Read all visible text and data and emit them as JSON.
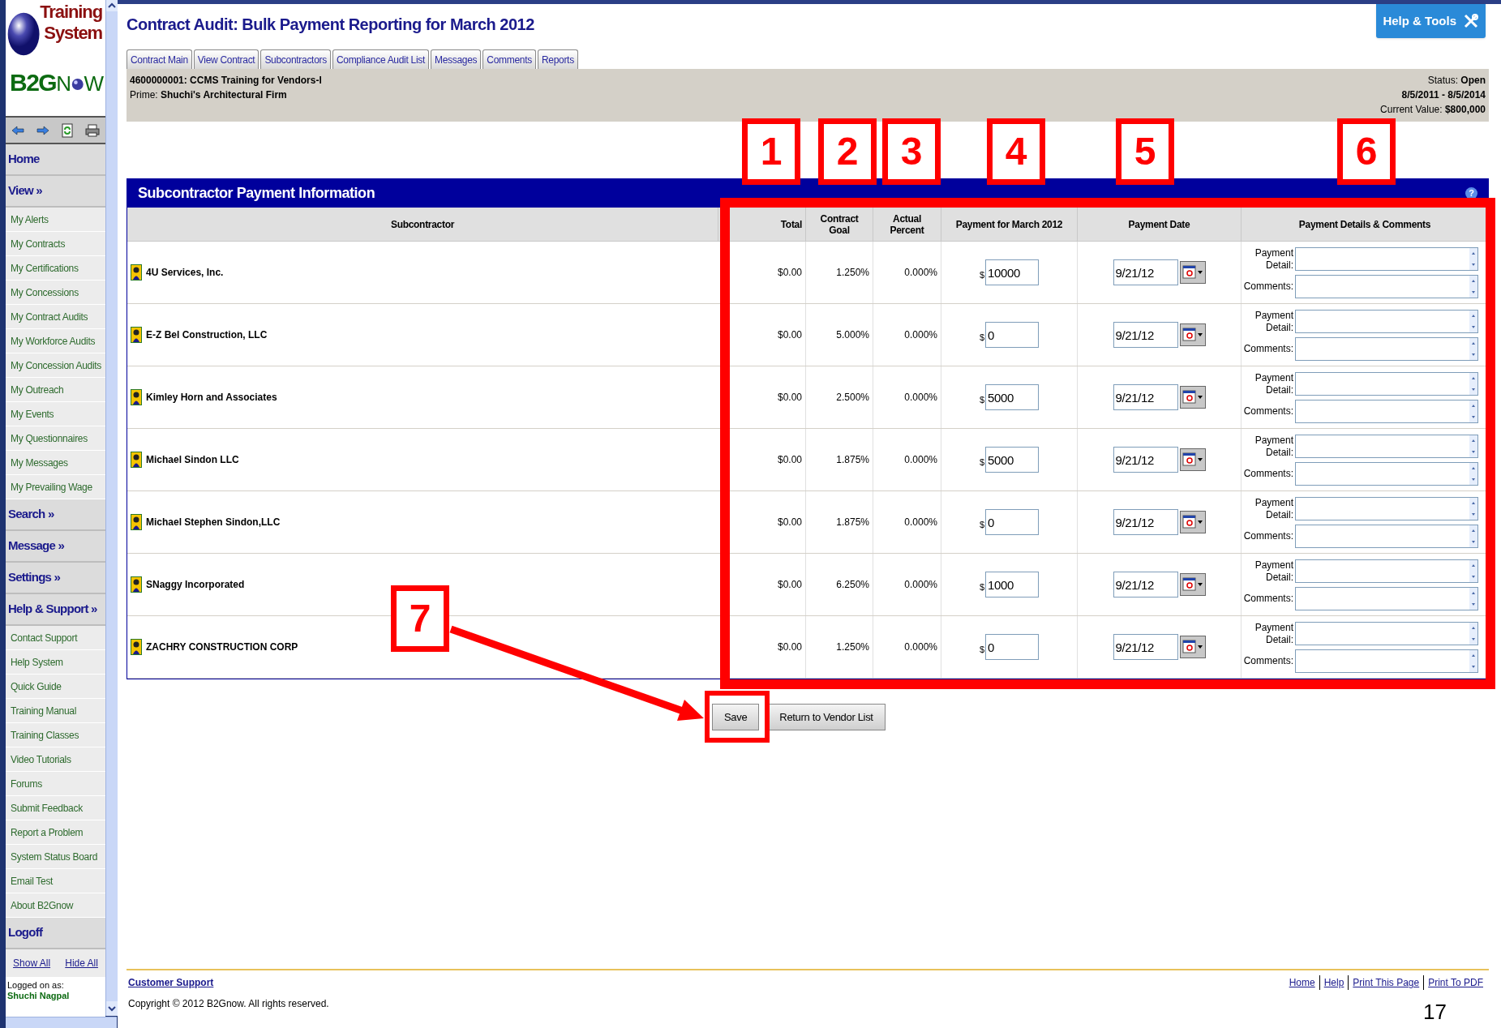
{
  "logo": {
    "line1": "Training",
    "line2": "System",
    "brand_start": "B2G",
    "brand_mid": "N",
    "brand_end": "W"
  },
  "sidebar": {
    "nav": [
      {
        "label": "Home",
        "kind": "section"
      },
      {
        "label": "View »",
        "kind": "section"
      },
      {
        "label": "My Alerts",
        "kind": "link"
      },
      {
        "label": "My Contracts",
        "kind": "link"
      },
      {
        "label": "My Certifications",
        "kind": "link"
      },
      {
        "label": "My Concessions",
        "kind": "link"
      },
      {
        "label": "My Contract Audits",
        "kind": "link"
      },
      {
        "label": "My Workforce Audits",
        "kind": "link"
      },
      {
        "label": "My Concession Audits",
        "kind": "link"
      },
      {
        "label": "My Outreach",
        "kind": "link"
      },
      {
        "label": "My Events",
        "kind": "link"
      },
      {
        "label": "My Questionnaires",
        "kind": "link"
      },
      {
        "label": "My Messages",
        "kind": "link"
      },
      {
        "label": "My Prevailing Wage",
        "kind": "link"
      },
      {
        "label": "Search »",
        "kind": "section"
      },
      {
        "label": "Message »",
        "kind": "section"
      },
      {
        "label": "Settings »",
        "kind": "section"
      },
      {
        "label": "Help & Support »",
        "kind": "section"
      },
      {
        "label": "Contact Support",
        "kind": "link"
      },
      {
        "label": "Help System",
        "kind": "link"
      },
      {
        "label": "Quick Guide",
        "kind": "link"
      },
      {
        "label": "Training Manual",
        "kind": "link"
      },
      {
        "label": "Training Classes",
        "kind": "link"
      },
      {
        "label": "Video Tutorials",
        "kind": "link"
      },
      {
        "label": "Forums",
        "kind": "link"
      },
      {
        "label": "Submit Feedback",
        "kind": "link"
      },
      {
        "label": "Report a Problem",
        "kind": "link"
      },
      {
        "label": "System Status Board",
        "kind": "link"
      },
      {
        "label": "Email Test",
        "kind": "link"
      },
      {
        "label": "About B2Gnow",
        "kind": "link"
      },
      {
        "label": "Logoff",
        "kind": "section"
      }
    ],
    "show_all": "Show All",
    "hide_all": "Hide All",
    "logged_on_label": "Logged on as:",
    "user_name": "Shuchi Nagpal"
  },
  "page_title": "Contract Audit: Bulk Payment Reporting for March 2012",
  "help_button": "Help & Tools",
  "tabs": [
    "Contract Main",
    "View Contract",
    "Subcontractors",
    "Compliance Audit List",
    "Messages",
    "Comments",
    "Reports"
  ],
  "contract": {
    "title": "4600000001: CCMS Training for Vendors-I",
    "prime": "Prime: **Shuchi's Architectural Firm**",
    "status": "Status: **Open**",
    "dates": "8/5/2011 - 8/5/2014",
    "value": "Current Value: **$800,000**"
  },
  "table": {
    "title": "Subcontractor Payment Information",
    "help_mark": "?",
    "columns": [
      "Subcontractor",
      "Total",
      "Contract Goal",
      "Actual Percent",
      "Payment for March 2012",
      "Payment Date",
      "Payment Details & Comments"
    ],
    "rows": [
      {
        "subcontractor": "4U Services, Inc.",
        "total": "$0.00",
        "contract_goal": "1.250%",
        "actual_percent": "0.000%",
        "currency": "$",
        "payment": "10000",
        "payment_date": "9/21/12",
        "detail_label": "Payment Detail:",
        "comments_label": "Comments:"
      },
      {
        "subcontractor": "E-Z Bel Construction, LLC",
        "total": "$0.00",
        "contract_goal": "5.000%",
        "actual_percent": "0.000%",
        "currency": "$",
        "payment": "0",
        "payment_date": "9/21/12",
        "detail_label": "Payment Detail:",
        "comments_label": "Comments:"
      },
      {
        "subcontractor": "Kimley Horn and Associates",
        "total": "$0.00",
        "contract_goal": "2.500%",
        "actual_percent": "0.000%",
        "currency": "$",
        "payment": "5000",
        "payment_date": "9/21/12",
        "detail_label": "Payment Detail:",
        "comments_label": "Comments:"
      },
      {
        "subcontractor": "Michael Sindon LLC",
        "total": "$0.00",
        "contract_goal": "1.875%",
        "actual_percent": "0.000%",
        "currency": "$",
        "payment": "5000",
        "payment_date": "9/21/12",
        "detail_label": "Payment Detail:",
        "comments_label": "Comments:"
      },
      {
        "subcontractor": "Michael Stephen Sindon,LLC",
        "total": "$0.00",
        "contract_goal": "1.875%",
        "actual_percent": "0.000%",
        "currency": "$",
        "payment": "0",
        "payment_date": "9/21/12",
        "detail_label": "Payment Detail:",
        "comments_label": "Comments:"
      },
      {
        "subcontractor": "SNaggy Incorporated",
        "total": "$0.00",
        "contract_goal": "6.250%",
        "actual_percent": "0.000%",
        "currency": "$",
        "payment": "1000",
        "payment_date": "9/21/12",
        "detail_label": "Payment Detail:",
        "comments_label": "Comments:"
      },
      {
        "subcontractor": "ZACHRY CONSTRUCTION CORP",
        "total": "$0.00",
        "contract_goal": "1.250%",
        "actual_percent": "0.000%",
        "currency": "$",
        "payment": "0",
        "payment_date": "9/21/12",
        "detail_label": "Payment Detail:",
        "comments_label": "Comments:"
      }
    ]
  },
  "buttons": [
    "Save",
    "Return to Vendor List"
  ],
  "footer": {
    "support_link": "Customer Support",
    "copyright": "Copyright © 2012 B2Gnow. All rights reserved.",
    "links": [
      "Home",
      "Help",
      "Print This Page",
      "Print To PDF"
    ]
  },
  "annotations": [
    {
      "label": "1"
    },
    {
      "label": "2"
    },
    {
      "label": "3"
    },
    {
      "label": "4"
    },
    {
      "label": "5"
    },
    {
      "label": "6"
    },
    {
      "label": "7"
    }
  ],
  "slide_number": "17"
}
